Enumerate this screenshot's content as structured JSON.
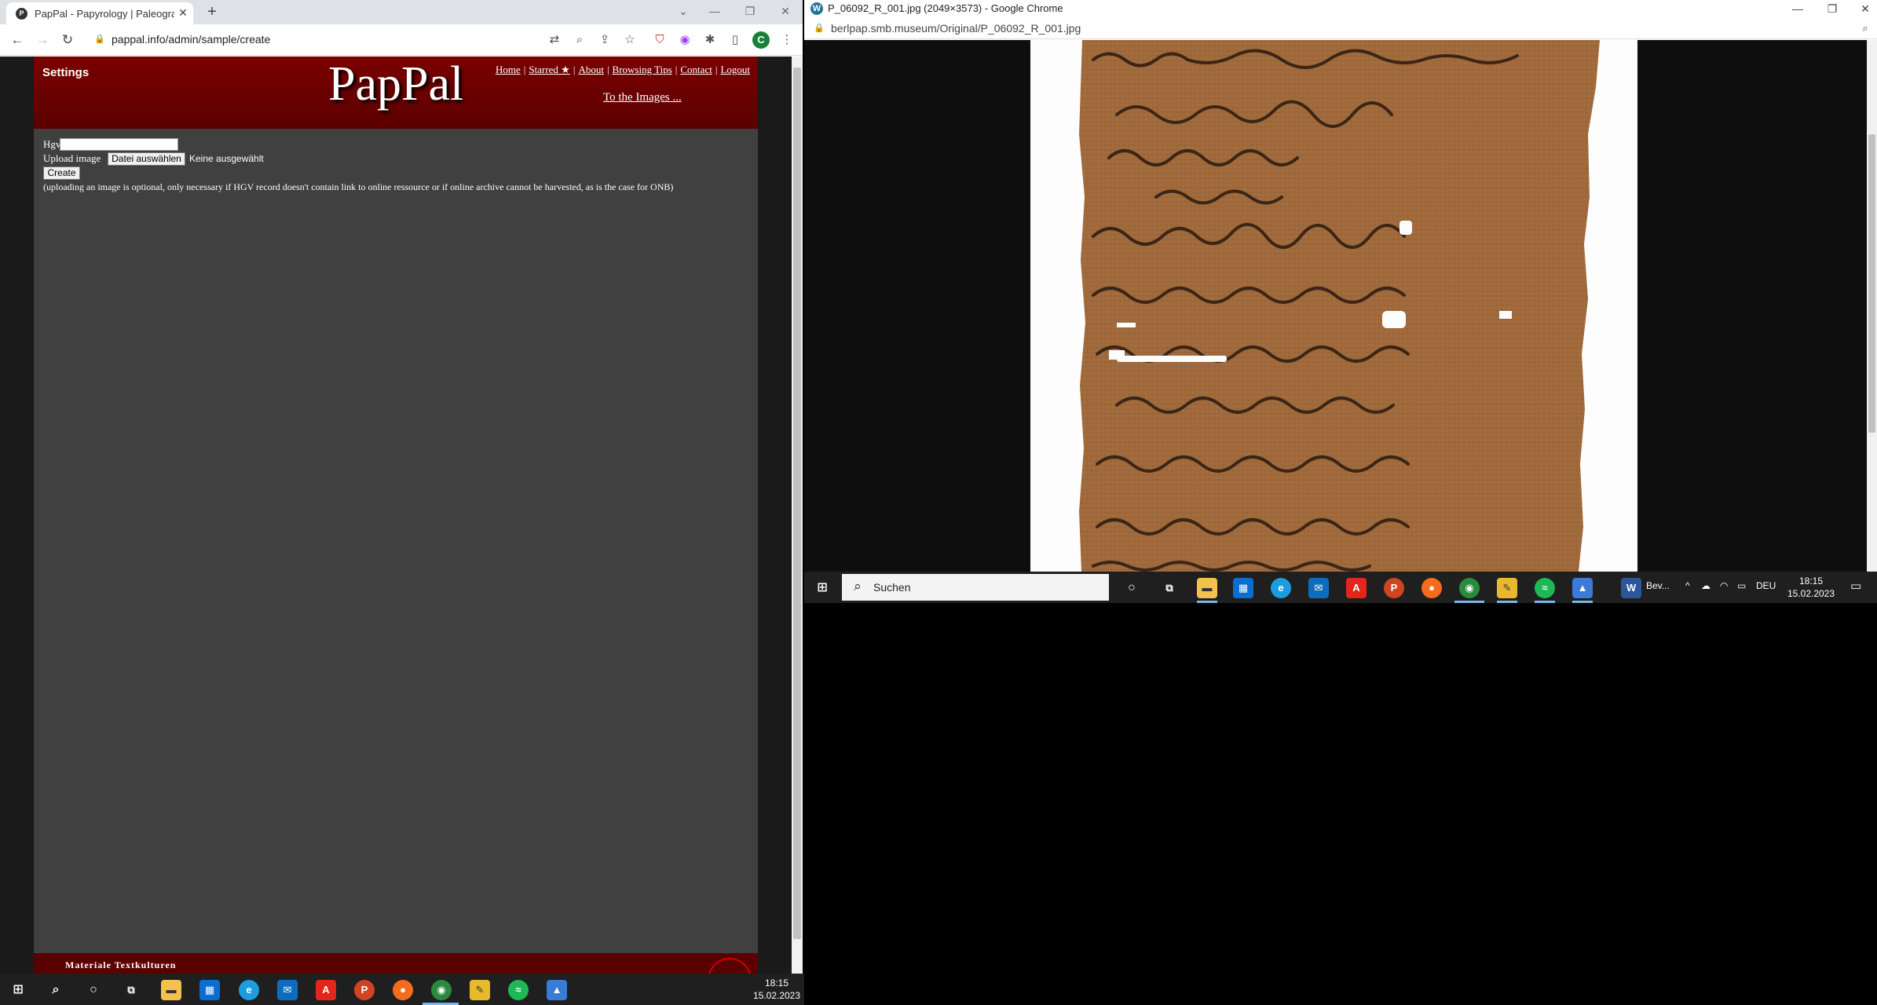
{
  "left_window": {
    "tab_title": "PapPal - Papyrology | Paleograph",
    "tab_favicon": "P",
    "url": "pappal.info/admin/sample/create",
    "profile_initial": "C",
    "page": {
      "settings": "Settings",
      "logo": "PapPal",
      "nav": [
        "Home",
        "Starred ★",
        "About",
        "Browsing Tips",
        "Contact",
        "Logout"
      ],
      "images_link": "To the Images ...",
      "form": {
        "hgv_label": "Hgv",
        "upload_label": "Upload image",
        "file_button": "Datei auswählen",
        "file_status": "Keine ausgewählt",
        "create_button": "Create",
        "hint": "(uploading an image is optional, only necessary if HGV record doesn't contain link to online ressource or if online archive cannot be harvested, as is the case for ONB)"
      },
      "footer_text": "Materiale Textkulturen"
    }
  },
  "right_window": {
    "title": "P_06092_R_001.jpg (2049×3573) - Google Chrome",
    "app_icon": "W",
    "url": "berlpap.smb.museum/Original/P_06092_R_001.jpg"
  },
  "right_taskbar": {
    "search_placeholder": "Suchen",
    "running_app_label": "Bev...",
    "language": "DEU",
    "time": "18:15",
    "date": "15.02.2023"
  },
  "bottom_taskbar": {
    "time": "18:15",
    "date": "15.02.2023"
  },
  "colors": {
    "pappal_header": "#6b0000",
    "pappal_body": "#404040",
    "taskbar": "#1f1f1f",
    "papyrus": "#a06a3c"
  }
}
